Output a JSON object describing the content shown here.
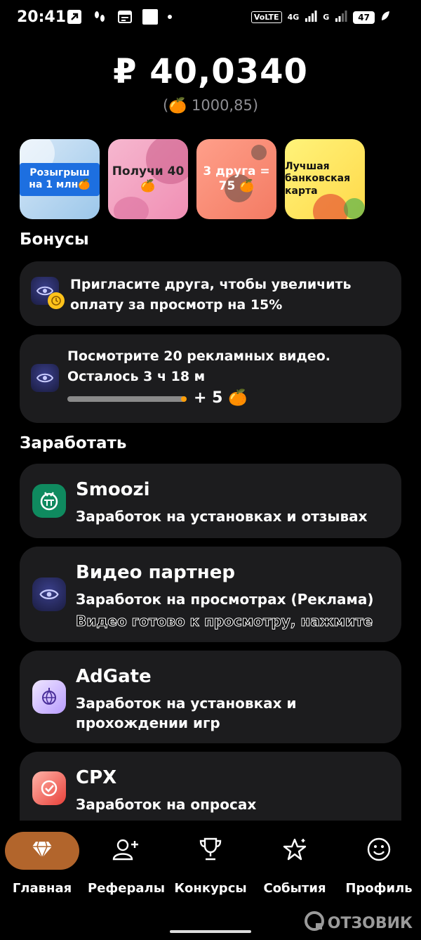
{
  "status": {
    "time": "20:41",
    "volte": "VoLTE",
    "net1": "4G",
    "net2": "G",
    "battery": "47"
  },
  "balance": {
    "main": "₽ 40,0340",
    "secondary": "(🍊 1000,85)"
  },
  "stories": [
    {
      "label": "Розыгрыш на 1 млн🍊"
    },
    {
      "label": "Получи 40 🍊"
    },
    {
      "label": "3 друга = 75 🍊"
    },
    {
      "label": "Лучшая банковская карта"
    }
  ],
  "bonuses": {
    "title": "Бонусы",
    "invite": {
      "text": "Пригласите друга, чтобы увеличить оплату за просмотр на 15%"
    },
    "videos": {
      "text": "Посмотрите 20 рекламных видео. Осталось 3 ч 18 м",
      "reward": "+ 5 🍊",
      "progress": 0.98
    }
  },
  "earn": {
    "title": "Заработать",
    "items": [
      {
        "title": "Smoozi",
        "subtitle": "Заработок на установках и отзывах",
        "icon": "smoozi-icon"
      },
      {
        "title": "Видео партнер",
        "subtitle": "Заработок на просмотрах (Реклама)",
        "note": "Видео готово к просмотру, нажмите",
        "icon": "eye-icon"
      },
      {
        "title": "AdGate",
        "subtitle": "Заработок на установках и прохождении игр",
        "icon": "globe-icon"
      },
      {
        "title": "CPX",
        "subtitle": "Заработок на опросах",
        "icon": "check-icon"
      }
    ]
  },
  "nav": [
    {
      "label": "Главная",
      "icon": "diamond-icon"
    },
    {
      "label": "Рефералы",
      "icon": "add-user-icon"
    },
    {
      "label": "Конкурсы",
      "icon": "trophy-icon"
    },
    {
      "label": "События",
      "icon": "star-icon"
    },
    {
      "label": "Профиль",
      "icon": "smile-icon"
    }
  ],
  "watermark": "ОТЗОВИК",
  "colors": {
    "accent": "#b2652c",
    "card": "#1c1c1e",
    "muted": "#8e8e93"
  }
}
